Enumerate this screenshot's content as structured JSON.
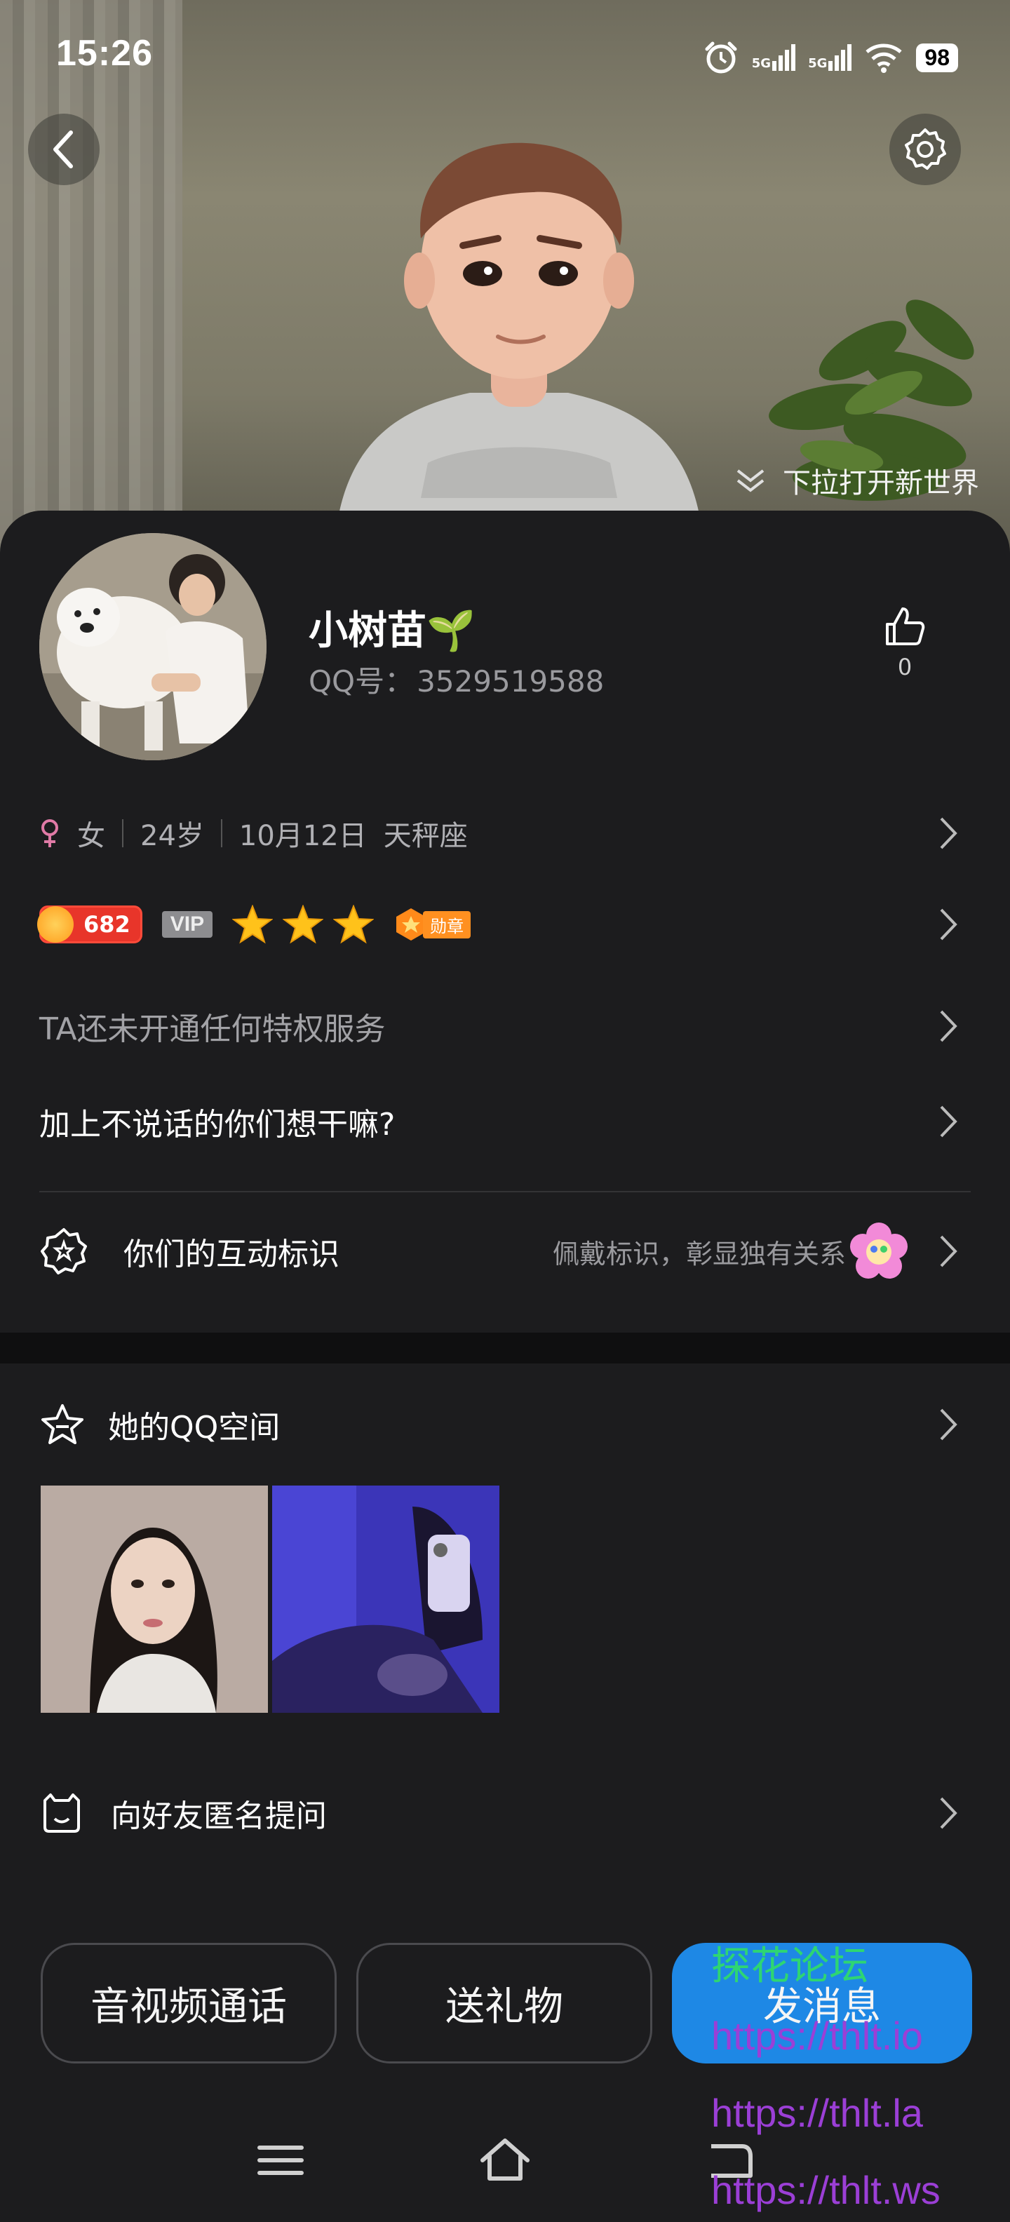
{
  "status_bar": {
    "time": "15:26",
    "signal_1": "5G",
    "signal_2": "5G",
    "battery": "98"
  },
  "header": {
    "pulldown_hint": "下拉打开新世界"
  },
  "profile": {
    "nickname": "小树苗🌱",
    "qq_label": "QQ号：",
    "qq_number": "3529519588",
    "like_count": "0",
    "gender_icon": "female-icon",
    "gender": "女",
    "age": "24岁",
    "birthday": "10月12日",
    "zodiac": "天秤座",
    "level": "682",
    "vip_label": "VIP",
    "star_count": 3,
    "medal_label": "勋章"
  },
  "rows": {
    "privilege": "TA还未开通任何特权服务",
    "add_prompt": "加上不说话的你们想干嘛?",
    "interaction_title": "你们的互动标识",
    "interaction_hint": "佩戴标识，彰显独有关系",
    "qzone_title": "她的QQ空间",
    "anon_question": "向好友匿名提问"
  },
  "actions": {
    "call": "音视频通话",
    "gift": "送礼物",
    "message": "发消息"
  },
  "watermark": {
    "line1": "探花论坛",
    "line2": "https://thlt.io",
    "line3": "https://thlt.la",
    "line4": "https://thlt.ws"
  },
  "colors": {
    "background": "#1c1c1e",
    "accent_blue": "#1e88e5",
    "level_red": "#e8352a",
    "gender_pink": "#e07aa6",
    "watermark_green": "#2ed573",
    "watermark_purple": "#9b3fd6",
    "watermark_red": "#ff2a2a"
  }
}
